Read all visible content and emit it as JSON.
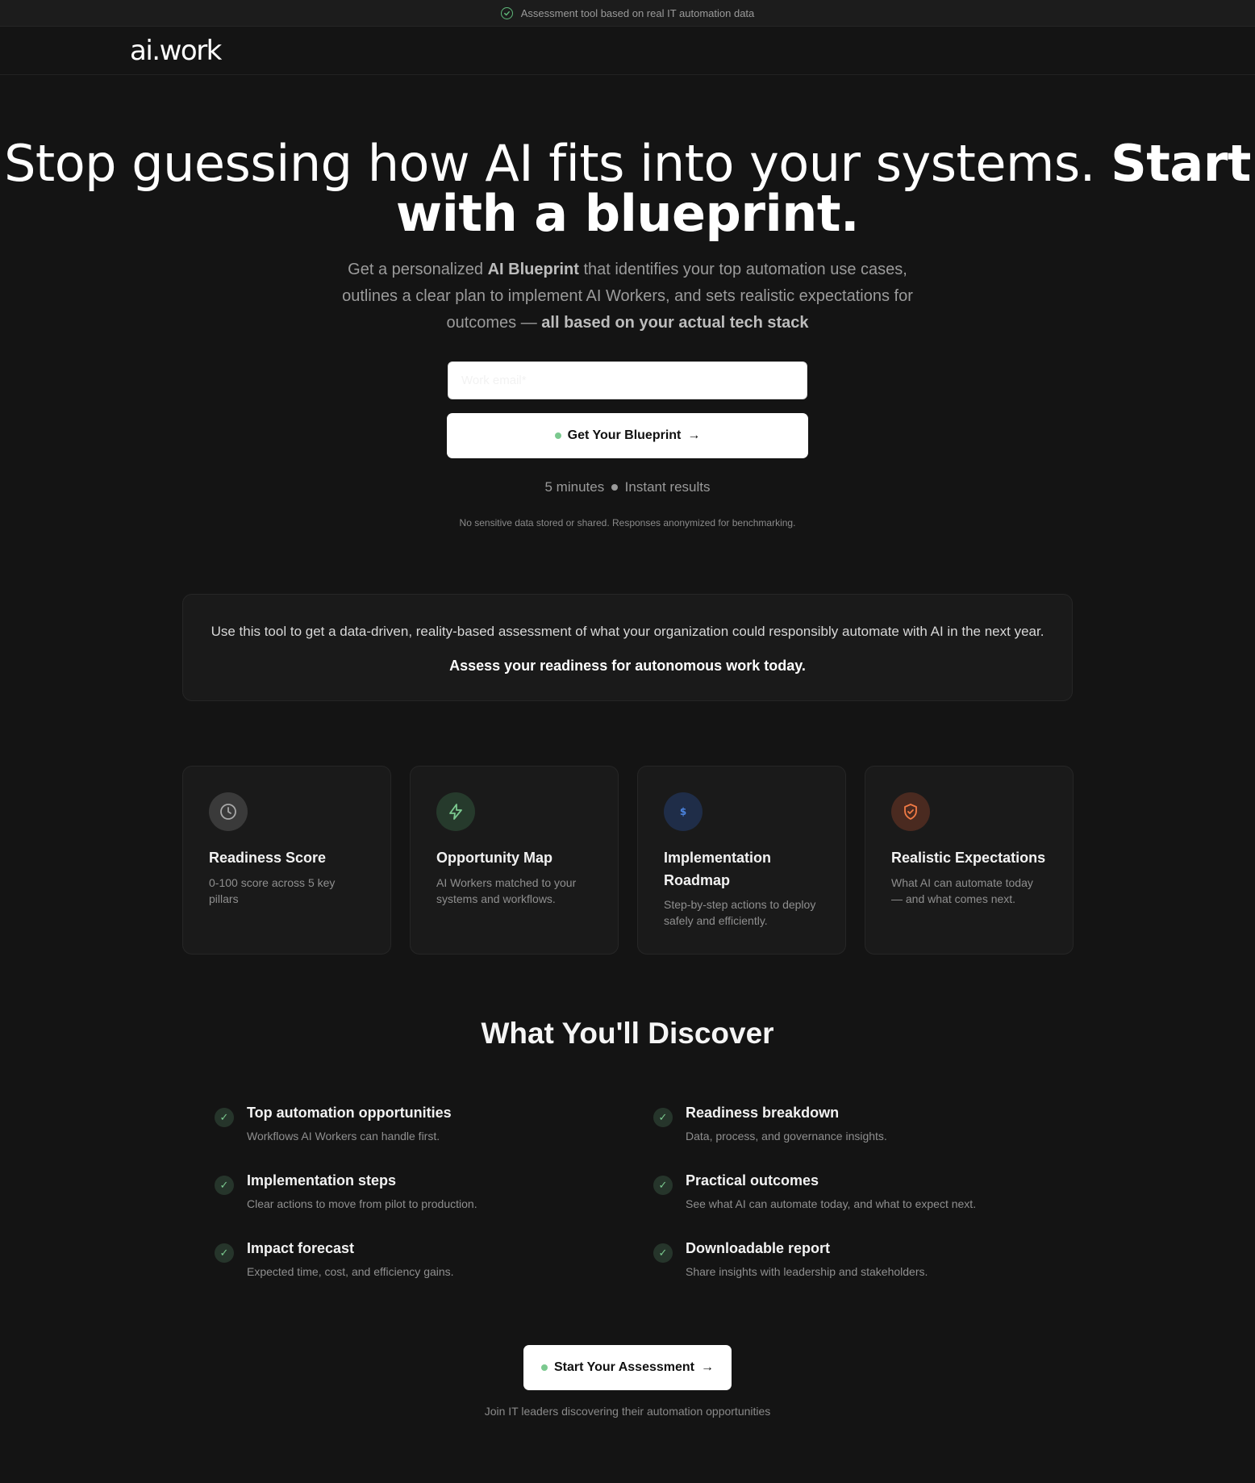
{
  "announcement": {
    "text": "Assessment tool based on real IT automation data"
  },
  "brand": {
    "logo": "ai.work"
  },
  "hero": {
    "title_regular": "Stop guessing how AI fits into your systems.",
    "title_bold": "Start with a blueprint.",
    "subtitle_pre": "Get a personalized ",
    "subtitle_bold1": "AI Blueprint",
    "subtitle_mid": " that identifies your top automation use cases, outlines a clear plan to implement AI Workers, and sets realistic expectations for outcomes — ",
    "subtitle_bold2": "all based on your actual tech stack",
    "email_placeholder": "Work email*",
    "email_value": "",
    "cta_label": "Get Your Blueprint",
    "cta_arrow": "→",
    "meta_duration": "5 minutes",
    "meta_results": "Instant results",
    "privacy_note": "No sensitive data stored or shared. Responses anonymized for benchmarking."
  },
  "info": {
    "line1": "Use this tool to get a data-driven, reality-based assessment of what your organization could responsibly automate with AI in the next year.",
    "line2": "Assess your readiness for autonomous work today."
  },
  "cards": [
    {
      "icon": "clock-icon",
      "color": "#3a3a3a",
      "icon_color": "#9a9a9a",
      "title": "Readiness Score",
      "desc": "0-100 score across 5 key pillars"
    },
    {
      "icon": "lightning-icon",
      "color": "#263a2c",
      "icon_color": "#7bc98f",
      "title": "Opportunity Map",
      "desc": "AI Workers matched to your systems and workflows."
    },
    {
      "icon": "dollar-icon",
      "color": "#1f2d48",
      "icon_color": "#4b84e0",
      "title": "Implementation Roadmap",
      "desc": "Step-by-step actions to deploy safely and efficiently."
    },
    {
      "icon": "shield-check-icon",
      "color": "#4a2a20",
      "icon_color": "#f07a45",
      "title": "Realistic Expectations",
      "desc": "What AI can automate today — and what comes next."
    }
  ],
  "discover": {
    "heading": "What You'll Discover",
    "items": [
      {
        "title": "Top automation opportunities",
        "desc": "Workflows AI Workers can handle first."
      },
      {
        "title": "Readiness breakdown",
        "desc": "Data, process, and governance insights."
      },
      {
        "title": "Implementation steps",
        "desc": "Clear actions to move from pilot to production."
      },
      {
        "title": "Practical outcomes",
        "desc": "See what AI can automate today, and what to expect next."
      },
      {
        "title": "Impact forecast",
        "desc": "Expected time, cost, and efficiency gains."
      },
      {
        "title": "Downloadable report",
        "desc": "Share insights with leadership and stakeholders."
      }
    ],
    "tick": "✓"
  },
  "footer_cta": {
    "label": "Start Your Assessment",
    "arrow": "→",
    "note": "Join IT leaders discovering their automation opportunities"
  }
}
